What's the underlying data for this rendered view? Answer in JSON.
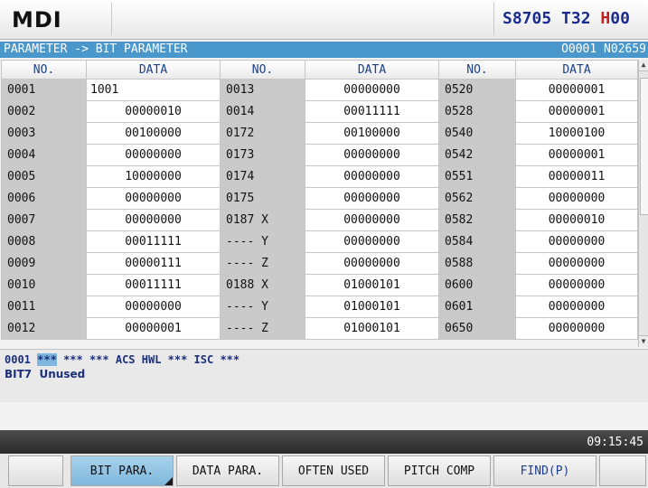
{
  "header": {
    "mode": "MDI",
    "status_s": "S8705",
    "status_t": "T32",
    "status_h_letter": "H",
    "status_h_value": "00"
  },
  "titlebar": {
    "path": "PARAMETER -> BIT PARAMETER",
    "program": "O0001 N02659"
  },
  "table": {
    "headers": [
      "NO.",
      "DATA",
      "NO.",
      "DATA",
      "NO.",
      "DATA"
    ],
    "rows": [
      [
        "0001",
        "1001",
        "0013",
        "00000000",
        "0520",
        "00000001"
      ],
      [
        "0002",
        "00000010",
        "0014",
        "00011111",
        "0528",
        "00000001"
      ],
      [
        "0003",
        "00100000",
        "0172",
        "00100000",
        "0540",
        "10000100"
      ],
      [
        "0004",
        "00000000",
        "0173",
        "00000000",
        "0542",
        "00000001"
      ],
      [
        "0005",
        "10000000",
        "0174",
        "00000000",
        "0551",
        "00000011"
      ],
      [
        "0006",
        "00000000",
        "0175",
        "00000000",
        "0562",
        "00000000"
      ],
      [
        "0007",
        "00000000",
        "0187 X",
        "00000000",
        "0582",
        "00000010"
      ],
      [
        "0008",
        "00011111",
        "---- Y",
        "00000000",
        "0584",
        "00000000"
      ],
      [
        "0009",
        "00000111",
        "---- Z",
        "00000000",
        "0588",
        "00000000"
      ],
      [
        "0010",
        "00011111",
        "0188 X",
        "01000101",
        "0600",
        "00000000"
      ],
      [
        "0011",
        "00000000",
        "---- Y",
        "01000101",
        "0601",
        "00000000"
      ],
      [
        "0012",
        "00000001",
        "---- Z",
        "01000101",
        "0650",
        "00000000"
      ]
    ]
  },
  "info": {
    "param_no": "0001",
    "highlighted_bit": "***",
    "bits_rest": "*** *** ACS HWL *** ISC ***",
    "bit_label": "BIT7",
    "bit_desc": "Unused"
  },
  "statusbar": {
    "time": "09:15:45"
  },
  "softkeys": [
    "",
    "BIT PARA.",
    "DATA PARA.",
    "OFTEN USED",
    "PITCH COMP",
    "FIND(P)",
    ""
  ],
  "icons": {
    "scroll_up": "▲",
    "scroll_down": "▼"
  },
  "colors": {
    "titlebar": "#4a97cc",
    "active_key": "#7fb7dd",
    "status_blue": "#1b2b8f",
    "status_red": "#c81e1e"
  }
}
